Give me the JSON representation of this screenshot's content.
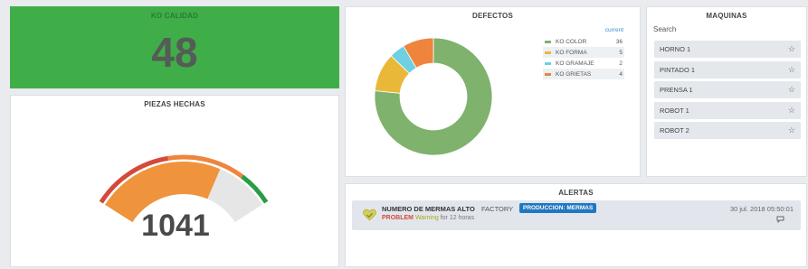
{
  "ko_calidad": {
    "title": "KO CALIDAD",
    "value": "48"
  },
  "piezas_hechas": {
    "title": "PIEZAS HECHAS",
    "value": "1041",
    "fill_fraction": 0.7
  },
  "defectos": {
    "title": "DEFECTOS",
    "legend_header": "current",
    "chart_data": {
      "type": "pie",
      "categories": [
        "KO COLOR",
        "KO FORMA",
        "KO GRAMAJE",
        "KO GRIETAS"
      ],
      "values": [
        36,
        5,
        2,
        4
      ],
      "colors": [
        "#7eb26d",
        "#eab839",
        "#6ed0e0",
        "#ef843c"
      ]
    }
  },
  "maquinas": {
    "title": "MAQUINAS",
    "search_label": "Search",
    "items": [
      {
        "label": "HORNO 1"
      },
      {
        "label": "PINTADO 1"
      },
      {
        "label": "PRENSA 1"
      },
      {
        "label": "ROBOT 1"
      },
      {
        "label": "ROBOT 2"
      }
    ]
  },
  "alertas": {
    "title": "ALERTAS",
    "item": {
      "name": "NUMERO DE MERMAS ALTO",
      "source": "FACTORY",
      "tag": "PRODUCCION: MERMAS",
      "state": "PROBLEM",
      "severity": "Warning",
      "duration": "for 12 horas",
      "time": "30 jul. 2018 05:50:01"
    }
  }
}
